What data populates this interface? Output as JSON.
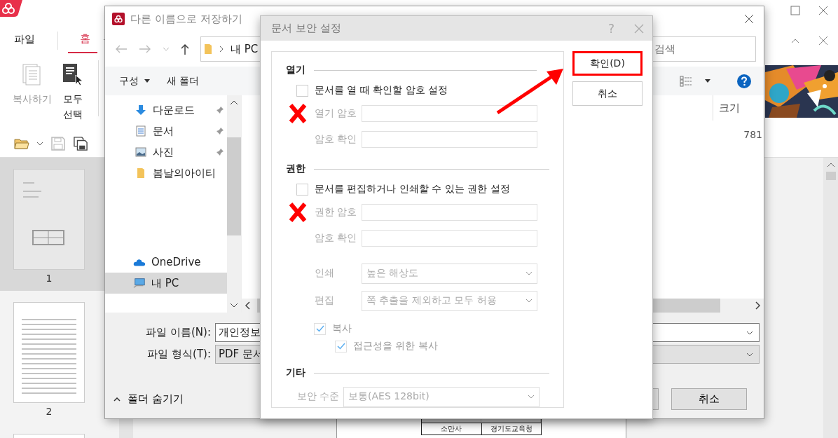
{
  "app": {
    "ribbon_tabs": [
      {
        "label": "파일",
        "selected": false
      },
      {
        "label": "홈",
        "selected": true
      }
    ],
    "ribbon_buttons": [
      {
        "kind": "copy",
        "label": "복사하기",
        "disabled": true
      },
      {
        "kind": "select",
        "label": "모두 선택",
        "disabled": false
      }
    ],
    "thumbnails": [
      {
        "page": "1",
        "selected": true
      },
      {
        "page": "2",
        "selected": false
      }
    ],
    "document_table": {
      "cells": [
        "소만사",
        "경기도교육청"
      ]
    }
  },
  "save_dialog": {
    "title": "다른 이름으로 저장하기",
    "address": "내 PC",
    "search_placeholder": "검색",
    "commands": [
      {
        "label": "구성",
        "dropdown": true
      },
      {
        "label": "새 폴더",
        "dropdown": false
      }
    ],
    "nav_groups": [
      [
        {
          "kind": "download",
          "label": "다운로드",
          "pinned": true,
          "selected": false
        },
        {
          "kind": "documents",
          "label": "문서",
          "pinned": true,
          "selected": false
        },
        {
          "kind": "pictures",
          "label": "사진",
          "pinned": true,
          "selected": false
        },
        {
          "kind": "folder",
          "label": "봄날의아이티",
          "pinned": false,
          "selected": false
        }
      ],
      [
        {
          "kind": "onedrive",
          "label": "OneDrive",
          "pinned": false,
          "selected": false
        },
        {
          "kind": "pc",
          "label": "내 PC",
          "pinned": false,
          "selected": true
        }
      ]
    ],
    "columns": [
      "크기"
    ],
    "rows": [
      {
        "size": "781"
      }
    ],
    "file_name_label": "파일 이름(N):",
    "file_name_value": "개인정보",
    "file_type_label": "파일 형식(T):",
    "file_type_value": "PDF 문서",
    "hide_folders": "폴더 숨기기",
    "cancel": "취소"
  },
  "security_dialog": {
    "title": "문서 보안 설정",
    "help": "?",
    "sections": [
      {
        "title": "열기",
        "items": [
          {
            "kind": "checkbox",
            "label": "문서를 열 때 확인할 암호 설정",
            "checked": false,
            "disabled": false
          },
          {
            "kind": "password",
            "label": "열기 암호",
            "disabled": true,
            "crossed": true
          },
          {
            "kind": "password",
            "label": "암호 확인",
            "disabled": true,
            "crossed": false
          }
        ]
      },
      {
        "title": "권한",
        "items": [
          {
            "kind": "checkbox",
            "label": "문서를 편집하거나 인쇄할 수 있는 권한 설정",
            "checked": false,
            "disabled": false
          },
          {
            "kind": "password",
            "label": "권한 암호",
            "disabled": true,
            "crossed": true
          },
          {
            "kind": "password",
            "label": "암호 확인",
            "disabled": true,
            "crossed": false
          },
          {
            "kind": "select",
            "label": "인쇄",
            "value": "높은 해상도",
            "disabled": true
          },
          {
            "kind": "select",
            "label": "편집",
            "value": "쪽 추출을 제외하고 모두 허용",
            "disabled": true
          },
          {
            "kind": "checkbox",
            "label": "복사",
            "checked": true,
            "disabled": true,
            "children": [
              {
                "kind": "checkbox",
                "label": "접근성을 위한 복사",
                "checked": true,
                "disabled": true
              }
            ]
          }
        ]
      },
      {
        "title": "기타",
        "items": [
          {
            "kind": "combo",
            "label": "보안 수준",
            "value": "보통(AES 128bit)",
            "disabled": true
          }
        ]
      }
    ],
    "buttons": [
      {
        "label": "확인(D)",
        "highlighted": true
      },
      {
        "label": "취소",
        "highlighted": false
      }
    ]
  }
}
